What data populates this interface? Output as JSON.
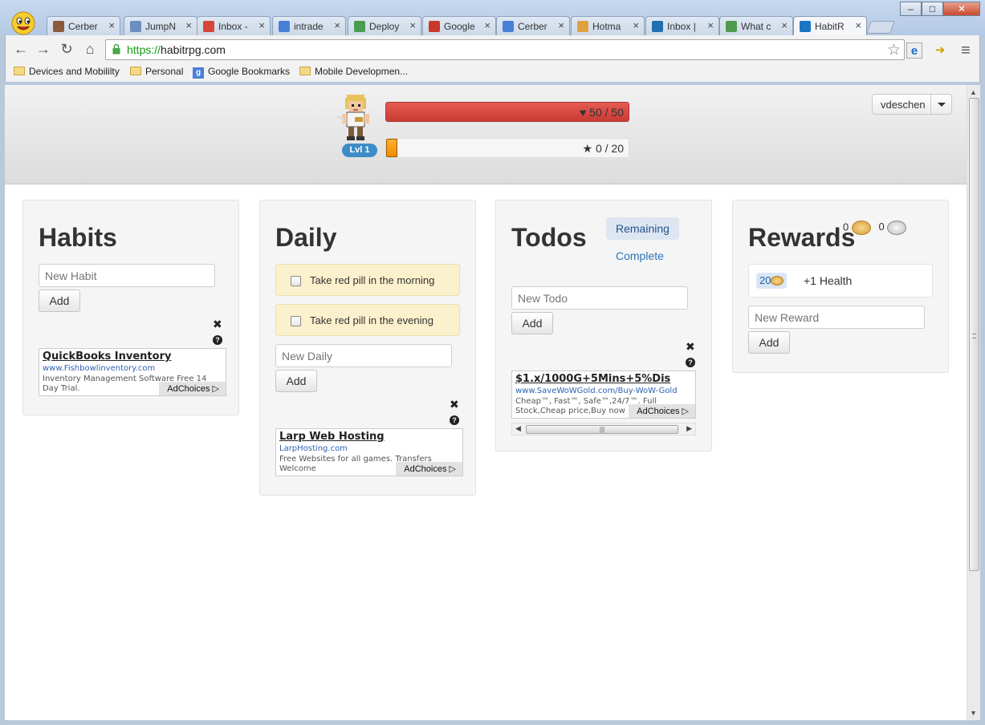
{
  "browser": {
    "tabs": [
      {
        "label": "Cerber",
        "color": "#8b5a3c"
      },
      {
        "label": "JumpN",
        "color": "#6d8dc0"
      },
      {
        "label": "Inbox -",
        "color": "#d44638"
      },
      {
        "label": "intrade",
        "color": "#4a7fd8"
      },
      {
        "label": "Deploy",
        "color": "#4a9c50"
      },
      {
        "label": "Google",
        "color": "#c8392b"
      },
      {
        "label": "Cerber",
        "color": "#4a7fd8"
      },
      {
        "label": "Hotma",
        "color": "#e0a040"
      },
      {
        "label": "Inbox |",
        "color": "#1f6fb2"
      },
      {
        "label": "What c",
        "color": "#4d9a4d"
      },
      {
        "label": "HabitR",
        "color": "#1b75c4"
      }
    ],
    "close_glyph": "×",
    "window_controls": {
      "minimize": "–",
      "maximize": "□",
      "close": "✕"
    },
    "url_scheme": "https://",
    "url_host": "habitrpg.com",
    "bookmarks": [
      {
        "label": "Devices and Mobililty",
        "icon": "folder-icon"
      },
      {
        "label": "Personal",
        "icon": "folder-icon"
      },
      {
        "label": "Google Bookmarks",
        "icon": "google-icon",
        "glyph": "g"
      },
      {
        "label": "Mobile Developmen...",
        "icon": "folder-icon"
      }
    ],
    "nav": {
      "back": "←",
      "forward": "→",
      "reload": "↻",
      "home": "⌂",
      "star": "☆",
      "menu": "≡"
    }
  },
  "header": {
    "level": "Lvl 1",
    "health": {
      "current": 50,
      "max": 50,
      "text": "50 / 50",
      "icon": "heart-icon",
      "glyph": "♥"
    },
    "experience": {
      "current": 0,
      "max": 20,
      "text": "0 / 20",
      "icon": "star-icon",
      "glyph": "★"
    },
    "username": "vdeschen"
  },
  "habits": {
    "title": "Habits",
    "input_placeholder": "New Habit",
    "add_label": "Add",
    "ad": {
      "title": "QuickBooks Inventory",
      "url": "www.Fishbowlinventory.com",
      "desc": "Inventory Management Software Free 14 Day Trial.",
      "choices": "AdChoices"
    }
  },
  "daily": {
    "title": "Daily",
    "items": [
      {
        "label": "Take red pill in the morning",
        "checked": false
      },
      {
        "label": "Take red pill in the evening",
        "checked": false
      }
    ],
    "input_placeholder": "New Daily",
    "add_label": "Add",
    "ad": {
      "title": "Larp Web Hosting",
      "url": "LarpHosting.com",
      "desc": "Free Websites for all games. Transfers Welcome",
      "choices": "AdChoices"
    }
  },
  "todos": {
    "title": "Todos",
    "filter_remaining": "Remaining",
    "filter_complete": "Complete",
    "input_placeholder": "New Todo",
    "add_label": "Add",
    "ad": {
      "title": "$1.x/1000G+5Mins+5%Dis",
      "url": "www.SaveWoWGold.com/Buy-WoW-Gold",
      "desc": "Cheap™, Fast™, Safe™,24/7™. Full Stock,Cheap price,Buy now",
      "choices": "AdChoices"
    }
  },
  "rewards": {
    "title": "Rewards",
    "gold": "0",
    "silver": "0",
    "item": {
      "price": "20",
      "label": "+1 Health"
    },
    "input_placeholder": "New Reward",
    "add_label": "Add"
  },
  "icons": {
    "close": "✖",
    "help": "?",
    "adchoices": "▷"
  },
  "colors": {
    "health": "#d9463e",
    "experience": "#f7a21b",
    "level_badge": "#3d8cc7",
    "daily_item": "#fcf1cd",
    "link": "#2b74b8"
  }
}
